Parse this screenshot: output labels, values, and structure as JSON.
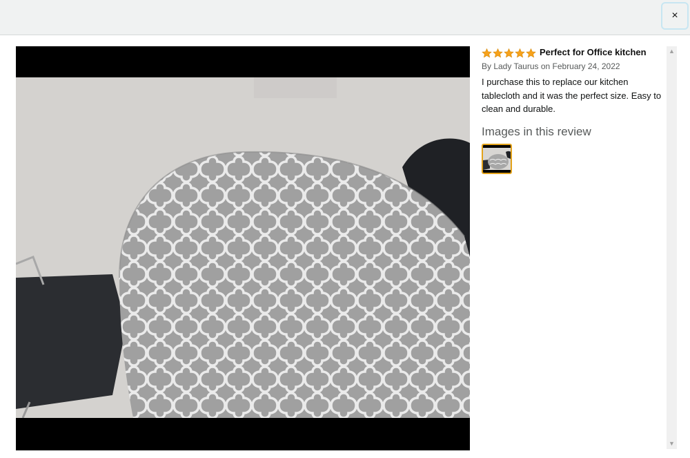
{
  "modal": {
    "close_label": "×"
  },
  "review": {
    "rating": 5,
    "rating_max": 5,
    "title": "Perfect for Office kitchen",
    "byline": "By Lady Taurus on February 24, 2022",
    "body": "I purchase this to replace our kitchen tablecloth and it was the perfect size. Easy to clean and durable.",
    "images_heading": "Images in this review",
    "thumbnail_icon": "tablecloth-thumbnail"
  },
  "colors": {
    "star": "#f7a21b",
    "thumbnail_border": "#e3a21a",
    "topbar": "#f0f2f2"
  },
  "icons": {
    "close": "close-icon",
    "star": "star-icon",
    "scroll_up": "scroll-up-arrow",
    "scroll_down": "scroll-down-arrow"
  },
  "scrollbar": {
    "up": "▲",
    "down": "▼"
  }
}
